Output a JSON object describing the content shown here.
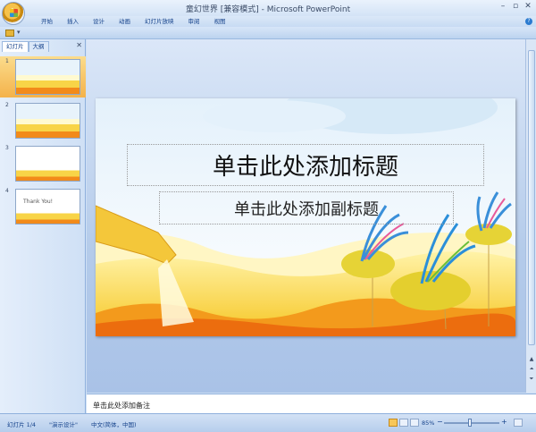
{
  "window": {
    "title": "童幻世界 [兼容模式] - Microsoft PowerPoint",
    "controls": [
      "–",
      "▫",
      "✕"
    ]
  },
  "ribbon": {
    "tabs": [
      "开始",
      "插入",
      "设计",
      "动画",
      "幻灯片放映",
      "审阅",
      "视图"
    ],
    "help": "?"
  },
  "qat": {
    "more": "▾"
  },
  "left_pane": {
    "tabs": [
      "幻灯片",
      "大纲"
    ],
    "close": "✕",
    "thumbnails": [
      {
        "num": "1",
        "text": ""
      },
      {
        "num": "2",
        "text": ""
      },
      {
        "num": "3",
        "text": ""
      },
      {
        "num": "4",
        "text": "Thank You!"
      }
    ]
  },
  "slide": {
    "title_placeholder": "单击此处添加标题",
    "subtitle_placeholder": "单击此处添加副标题"
  },
  "notes": {
    "placeholder": "单击此处添加备注"
  },
  "status": {
    "slide_count": "幻灯片 1/4",
    "theme": "\"演示设计\"",
    "language": "中文(简体，中国)",
    "zoom": "85%",
    "zoom_minus": "−",
    "zoom_plus": "+"
  },
  "colors": {
    "accent": "#15428b",
    "selected_thumb": "#f4b24a"
  }
}
